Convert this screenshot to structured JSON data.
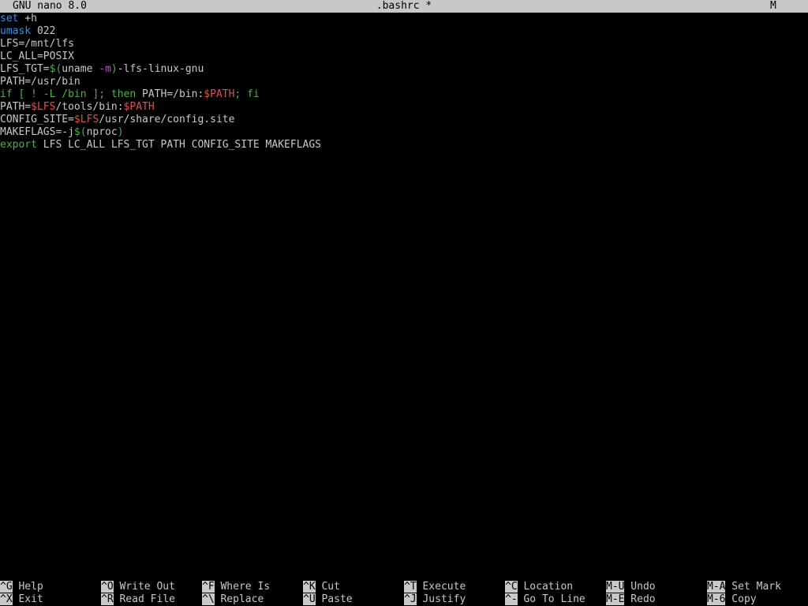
{
  "titlebar": {
    "app": "GNU nano 8.0",
    "file": ".bashrc *",
    "flag": "M"
  },
  "lines": [
    [
      {
        "t": "set",
        "c": "kw"
      },
      {
        "t": " +h",
        "c": "plain"
      }
    ],
    [
      {
        "t": "umask",
        "c": "kw"
      },
      {
        "t": " 022",
        "c": "plain"
      }
    ],
    [
      {
        "t": "LFS=/mnt/lfs",
        "c": "plain"
      }
    ],
    [
      {
        "t": "LC_ALL=POSIX",
        "c": "plain"
      }
    ],
    [
      {
        "t": "LFS_TGT=",
        "c": "plain"
      },
      {
        "t": "$(",
        "c": "green"
      },
      {
        "t": "uname ",
        "c": "plain"
      },
      {
        "t": "-m",
        "c": "opt"
      },
      {
        "t": ")",
        "c": "green"
      },
      {
        "t": "-lfs-linux-gnu",
        "c": "plain"
      }
    ],
    [
      {
        "t": "PATH=/usr/bin",
        "c": "plain"
      }
    ],
    [
      {
        "t": "if [ ! -L /bin ]; then",
        "c": "green"
      },
      {
        "t": " PATH=/bin:",
        "c": "plain"
      },
      {
        "t": "$PATH",
        "c": "var"
      },
      {
        "t": "; fi",
        "c": "green"
      }
    ],
    [
      {
        "t": "PATH=",
        "c": "plain"
      },
      {
        "t": "$LFS",
        "c": "var"
      },
      {
        "t": "/tools/bin:",
        "c": "plain"
      },
      {
        "t": "$PATH",
        "c": "var"
      }
    ],
    [
      {
        "t": "CONFIG_SITE=",
        "c": "plain"
      },
      {
        "t": "$LFS",
        "c": "var"
      },
      {
        "t": "/usr/share/config.site",
        "c": "plain"
      }
    ],
    [
      {
        "t": "MAKEFLAGS=-j",
        "c": "plain"
      },
      {
        "t": "$(",
        "c": "green"
      },
      {
        "t": "nproc",
        "c": "plain"
      },
      {
        "t": ")",
        "c": "green"
      }
    ],
    [
      {
        "t": "export",
        "c": "green"
      },
      {
        "t": " LFS LC_ALL LFS_TGT PATH CONFIG_SITE MAKEFLAGS",
        "c": "plain"
      }
    ]
  ],
  "shortcuts": [
    [
      {
        "key": "^G",
        "label": "Help"
      },
      {
        "key": "^X",
        "label": "Exit"
      }
    ],
    [
      {
        "key": "^O",
        "label": "Write Out"
      },
      {
        "key": "^R",
        "label": "Read File"
      }
    ],
    [
      {
        "key": "^F",
        "label": "Where Is"
      },
      {
        "key": "^\\",
        "label": "Replace"
      }
    ],
    [
      {
        "key": "^K",
        "label": "Cut"
      },
      {
        "key": "^U",
        "label": "Paste"
      }
    ],
    [
      {
        "key": "^T",
        "label": "Execute"
      },
      {
        "key": "^J",
        "label": "Justify"
      }
    ],
    [
      {
        "key": "^C",
        "label": "Location"
      },
      {
        "key": "^-",
        "label": "Go To Line"
      }
    ],
    [
      {
        "key": "M-U",
        "label": "Undo"
      },
      {
        "key": "M-E",
        "label": "Redo"
      }
    ],
    [
      {
        "key": "M-A",
        "label": "Set Mark"
      },
      {
        "key": "M-6",
        "label": "Copy"
      }
    ]
  ],
  "colors": {
    "background": "#000000",
    "foreground": "#c8c8c8",
    "keyword": "#3b8eea",
    "green": "#4fae4f",
    "variable": "#e05050",
    "option": "#c050c0"
  }
}
